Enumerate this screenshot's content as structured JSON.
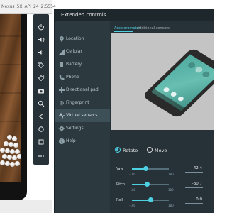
{
  "emulator": {
    "title": "Nexus_5X_API_24_2:5554",
    "toolbar": {
      "buttons": [
        {
          "name": "power-icon"
        },
        {
          "name": "volume-up-icon"
        },
        {
          "name": "volume-down-icon"
        },
        {
          "name": "rotate-left-icon"
        },
        {
          "name": "rotate-right-icon"
        },
        {
          "name": "camera-icon"
        },
        {
          "name": "zoom-icon"
        },
        {
          "name": "back-icon"
        },
        {
          "name": "home-icon"
        },
        {
          "name": "overview-icon"
        },
        {
          "name": "more-icon"
        }
      ]
    }
  },
  "extended": {
    "title": "Extended controls",
    "sidebar": {
      "items": [
        {
          "label": "Location",
          "icon": "location-icon"
        },
        {
          "label": "Cellular",
          "icon": "cellular-icon"
        },
        {
          "label": "Battery",
          "icon": "battery-icon"
        },
        {
          "label": "Phone",
          "icon": "phone-icon"
        },
        {
          "label": "Directional pad",
          "icon": "dpad-icon"
        },
        {
          "label": "Fingerprint",
          "icon": "fingerprint-icon"
        },
        {
          "label": "Virtual sensors",
          "icon": "sensors-icon",
          "active": true
        },
        {
          "label": "Settings",
          "icon": "settings-icon"
        },
        {
          "label": "Help",
          "icon": "help-icon"
        }
      ]
    },
    "tabs": [
      {
        "label": "Accelerometer",
        "active": true
      },
      {
        "label": "Additional sensors",
        "active": false
      }
    ],
    "mode": {
      "rotate_label": "Rotate",
      "move_label": "Move",
      "selected": "Rotate"
    },
    "sliders": [
      {
        "label": "Yaw",
        "min": "-180",
        "max": "180",
        "value": "-42.4",
        "fraction": 0.382
      },
      {
        "label": "Pitch",
        "min": "-180",
        "max": "180",
        "value": "-30.7",
        "fraction": 0.415
      },
      {
        "label": "Roll",
        "min": "-180",
        "max": "180",
        "value": "0.0",
        "fraction": 0.5
      }
    ],
    "accent_color": "#4dd0e1"
  }
}
